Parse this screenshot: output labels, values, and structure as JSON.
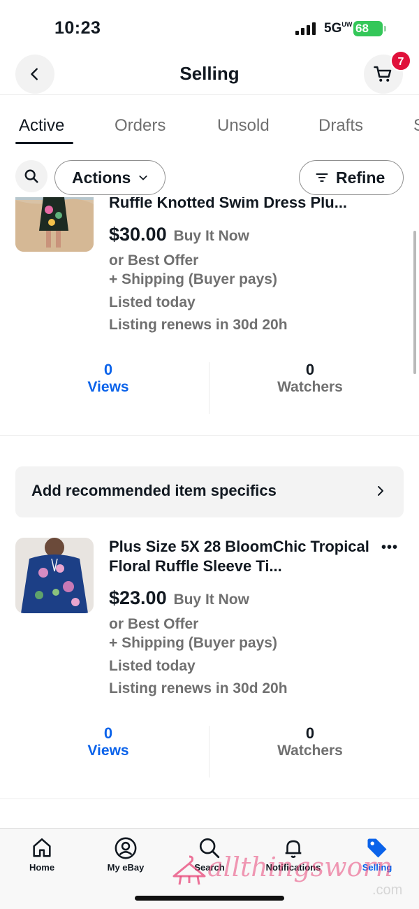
{
  "status_bar": {
    "time": "10:23",
    "network": "5G",
    "network_sub": "UW",
    "battery": "68"
  },
  "header": {
    "title": "Selling",
    "cart_count": "7"
  },
  "tabs": [
    {
      "label": "Active",
      "active": true
    },
    {
      "label": "Orders"
    },
    {
      "label": "Unsold"
    },
    {
      "label": "Drafts"
    },
    {
      "label": "S"
    }
  ],
  "filters": {
    "actions_label": "Actions",
    "refine_label": "Refine"
  },
  "listings": [
    {
      "title": "Ruffle Knotted Swim Dress Plu...",
      "price": "$30.00",
      "format": "Buy It Now",
      "offer": "or Best Offer",
      "shipping": "+ Shipping (Buyer pays)",
      "listed": "Listed today",
      "renews": "Listing renews in 30d 20h",
      "views": "0",
      "views_label": "Views",
      "watchers": "0",
      "watchers_label": "Watchers"
    },
    {
      "title": "Plus Size 5X 28 BloomChic Tropical Floral Ruffle Sleeve Ti...",
      "price": "$23.00",
      "format": "Buy It Now",
      "offer": "or Best Offer",
      "shipping": "+ Shipping (Buyer pays)",
      "listed": "Listed today",
      "renews": "Listing renews in 30d 20h",
      "views": "0",
      "views_label": "Views",
      "watchers": "0",
      "watchers_label": "Watchers"
    }
  ],
  "banner": {
    "label": "Add recommended item specifics"
  },
  "bottom_nav": [
    {
      "label": "Home",
      "icon": "home-icon"
    },
    {
      "label": "My eBay",
      "icon": "user-icon"
    },
    {
      "label": "Search",
      "icon": "search-icon"
    },
    {
      "label": "Notifications",
      "icon": "bell-icon"
    },
    {
      "label": "Selling",
      "icon": "tag-icon",
      "active": true
    }
  ],
  "watermark": {
    "text": "allthingsworn",
    "suffix": ".com"
  },
  "colors": {
    "accent": "#0b63ea",
    "badge": "#e0103a",
    "battery": "#34c759",
    "muted": "#707070"
  }
}
